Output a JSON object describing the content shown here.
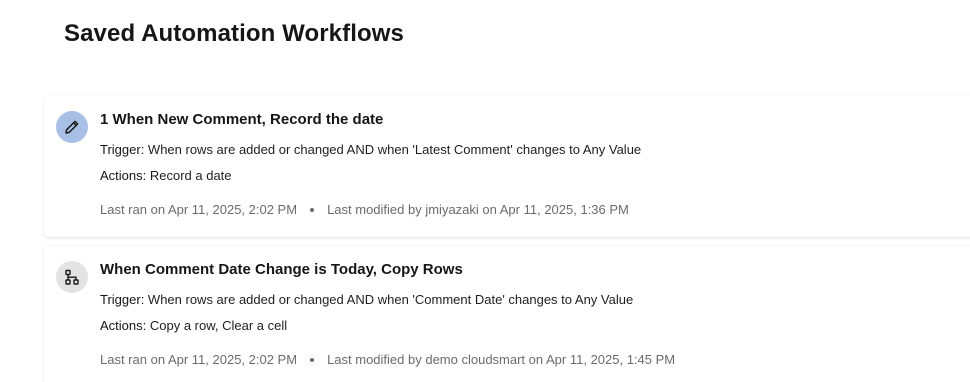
{
  "page": {
    "title": "Saved Automation Workflows"
  },
  "workflows": [
    {
      "icon": "pencil-icon",
      "title": "1 When New Comment, Record the date",
      "trigger_label": "Trigger:",
      "trigger": " When rows are added or changed AND when 'Latest Comment' changes to Any Value",
      "actions_label": "Actions:",
      "actions": " Record a date",
      "last_ran": "Last ran on Apr 11, 2025, 2:02 PM",
      "last_modified": "Last modified by jmiyazaki on Apr 11, 2025, 1:36 PM"
    },
    {
      "icon": "workflow-icon",
      "title": "When Comment Date Change is Today, Copy Rows",
      "trigger_label": "Trigger:",
      "trigger": " When rows are added or changed AND when 'Comment Date' changes to Any Value",
      "actions_label": "Actions:",
      "actions": " Copy a row, Clear a cell",
      "last_ran": "Last ran on Apr 11, 2025, 2:02 PM",
      "last_modified": "Last modified by demo cloudsmart on Apr 11, 2025, 1:45 PM"
    }
  ],
  "colors": {
    "pencil_icon_bg": "#a9c0e6",
    "workflow_icon_bg": "#e3e3e3",
    "muted_text": "#6b6b6b"
  }
}
